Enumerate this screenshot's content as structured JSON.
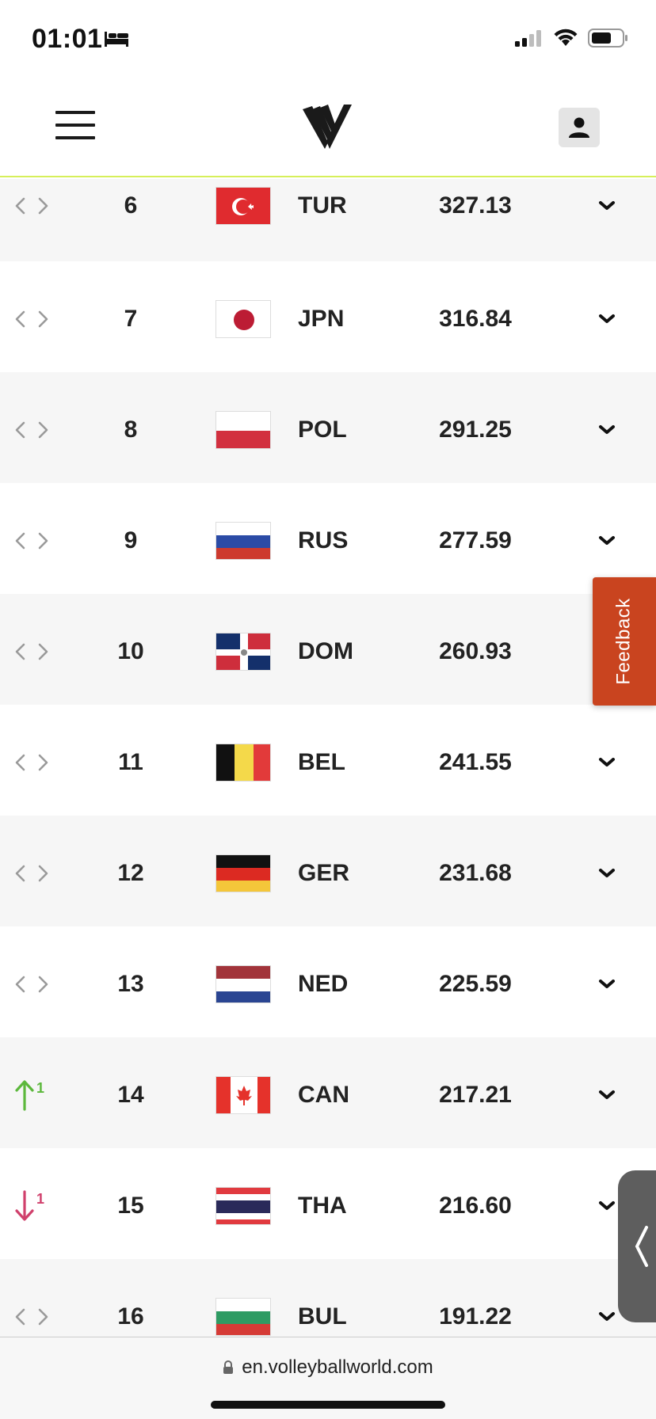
{
  "status_bar": {
    "time": "01:01",
    "sleep_icon": "bed-icon",
    "signal_icon": "cellular-signal-icon",
    "wifi_icon": "wifi-icon",
    "battery_icon": "battery-icon"
  },
  "header": {
    "menu_icon": "hamburger-menu-icon",
    "logo_icon": "volleyball-world-logo",
    "user_icon": "user-icon",
    "accent_color": "#d6ef5a"
  },
  "rankings": [
    {
      "move": "none",
      "move_value": "",
      "rank": "6",
      "code": "TUR",
      "points": "327.13",
      "flag": "tur"
    },
    {
      "move": "none",
      "move_value": "",
      "rank": "7",
      "code": "JPN",
      "points": "316.84",
      "flag": "jpn"
    },
    {
      "move": "none",
      "move_value": "",
      "rank": "8",
      "code": "POL",
      "points": "291.25",
      "flag": "pol"
    },
    {
      "move": "none",
      "move_value": "",
      "rank": "9",
      "code": "RUS",
      "points": "277.59",
      "flag": "rus"
    },
    {
      "move": "none",
      "move_value": "",
      "rank": "10",
      "code": "DOM",
      "points": "260.93",
      "flag": "dom"
    },
    {
      "move": "none",
      "move_value": "",
      "rank": "11",
      "code": "BEL",
      "points": "241.55",
      "flag": "bel"
    },
    {
      "move": "none",
      "move_value": "",
      "rank": "12",
      "code": "GER",
      "points": "231.68",
      "flag": "ger"
    },
    {
      "move": "none",
      "move_value": "",
      "rank": "13",
      "code": "NED",
      "points": "225.59",
      "flag": "ned"
    },
    {
      "move": "up",
      "move_value": "1",
      "rank": "14",
      "code": "CAN",
      "points": "217.21",
      "flag": "can"
    },
    {
      "move": "down",
      "move_value": "1",
      "rank": "15",
      "code": "THA",
      "points": "216.60",
      "flag": "tha"
    },
    {
      "move": "none",
      "move_value": "",
      "rank": "16",
      "code": "BUL",
      "points": "191.22",
      "flag": "bul"
    }
  ],
  "colors": {
    "up": "#5cb83c",
    "down": "#d0406c",
    "neutral": "#9a9a9a",
    "feedback_bg": "#c9441f"
  },
  "feedback": {
    "label": "Feedback"
  },
  "address_bar": {
    "url": "en.volleyballworld.com",
    "lock_icon": "lock-icon"
  }
}
